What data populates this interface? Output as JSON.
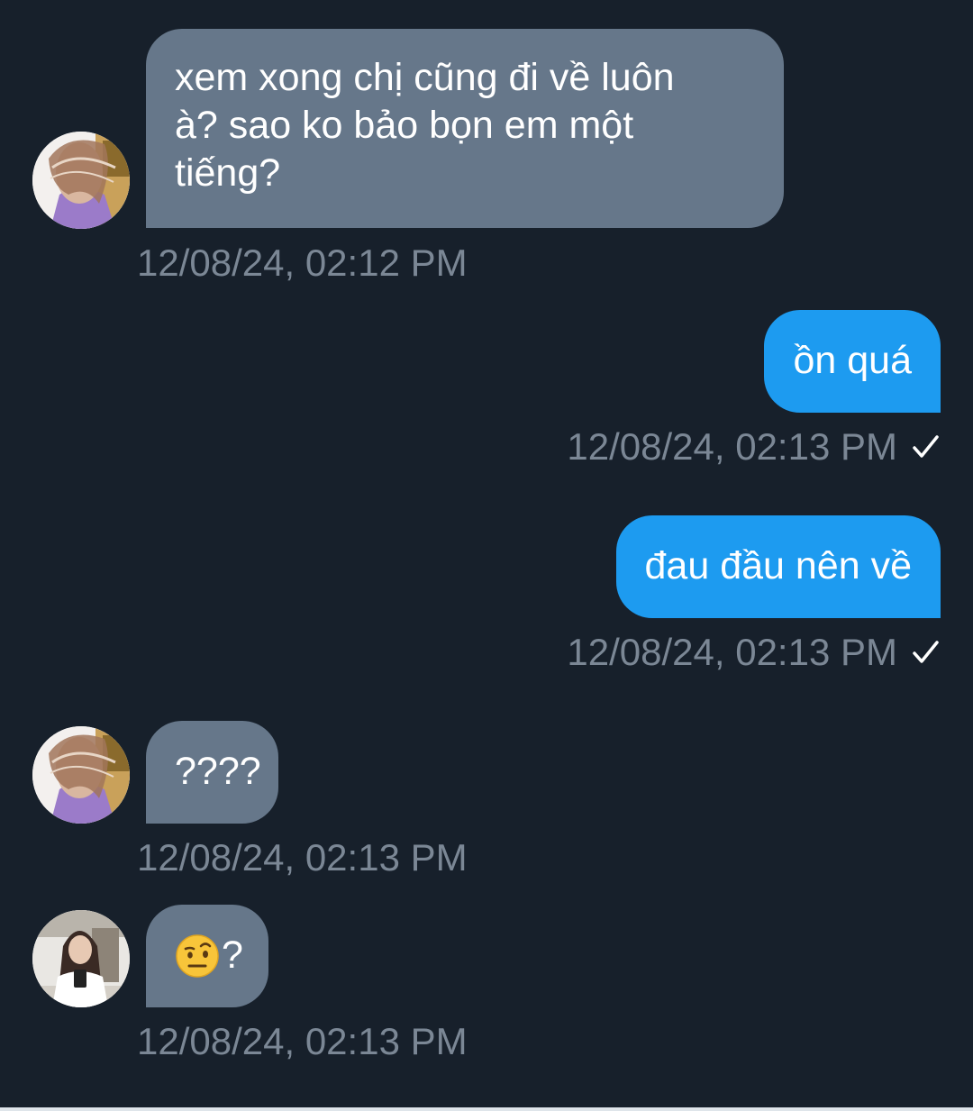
{
  "messages": [
    {
      "direction": "incoming",
      "text": "xem xong chị cũng đi về luôn\nà? sao ko bảo bọn em một\ntiếng?",
      "timestamp": "12/08/24, 02:12 PM",
      "avatar": "avatar-1"
    },
    {
      "direction": "outgoing",
      "text": "ồn quá",
      "timestamp": "12/08/24, 02:13 PM",
      "status": "check-icon"
    },
    {
      "direction": "outgoing",
      "text": "đau đầu nên về",
      "timestamp": "12/08/24, 02:13 PM",
      "status": "check-icon"
    },
    {
      "direction": "incoming",
      "text": "????",
      "timestamp": "12/08/24, 02:13 PM",
      "avatar": "avatar-1"
    },
    {
      "direction": "incoming",
      "emoji": "face-with-raised-eyebrow-emoji",
      "text": "?",
      "timestamp": "12/08/24, 02:13 PM",
      "avatar": "avatar-2"
    }
  ],
  "colors": {
    "background": "#17202b",
    "incoming_bubble": "#66778a",
    "outgoing_bubble": "#1d9bf0",
    "timestamp": "#7b8795"
  }
}
